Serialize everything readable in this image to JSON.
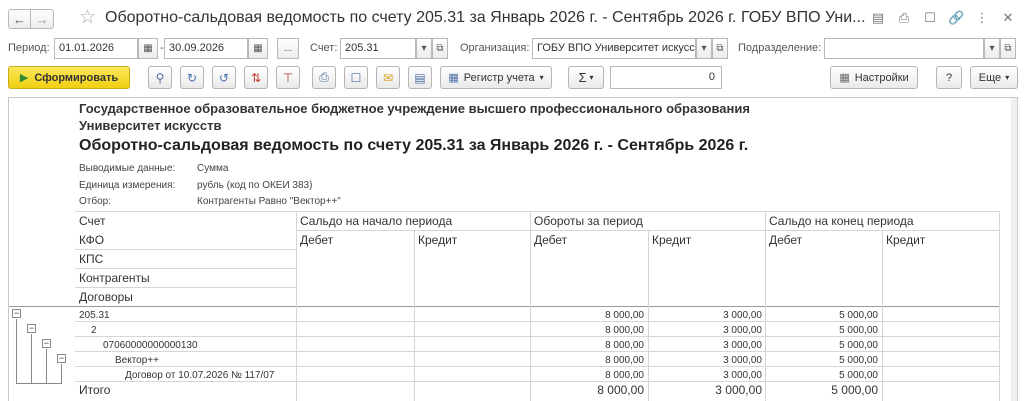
{
  "window": {
    "title": "Оборотно-сальдовая ведомость по счету 205.31 за Январь 2026 г. - Сентябрь 2026 г. ГОБУ ВПО Уни..."
  },
  "params": {
    "period_label": "Период:",
    "date_from": "01.01.2026",
    "date_to": "30.09.2026",
    "dots": "...",
    "account_label": "Счет:",
    "account_value": "205.31",
    "org_label": "Организация:",
    "org_value": "ГОБУ ВПО Университет искусс",
    "subdiv_label": "Подразделение:",
    "subdiv_value": ""
  },
  "toolbar": {
    "generate": "Сформировать",
    "register": "Регистр учета",
    "sigma": "Σ",
    "sum_value": "0",
    "settings": "Настройки",
    "help": "?",
    "more": "Еще"
  },
  "report": {
    "org_line1": "Государственное образовательное бюджетное учреждение высшего профессионального образования",
    "org_line2": "Университет искусств",
    "title": "Оборотно-сальдовая ведомость по счету 205.31 за Январь 2026 г. - Сентябрь 2026 г.",
    "meta": [
      {
        "label": "Выводимые данные:",
        "value": "Сумма"
      },
      {
        "label": "Единица измерения:",
        "value": "рубль (код по ОКЕИ 383)"
      },
      {
        "label": "Отбор:",
        "value": "Контрагенты Равно \"Вектор++\""
      }
    ],
    "header": {
      "col_account": "Счет",
      "col_kfo": "КФО",
      "col_kps": "КПС",
      "col_contractors": "Контрагенты",
      "col_contracts": "Договоры",
      "group_start": "Сальдо на начало периода",
      "group_turnover": "Обороты за период",
      "group_end": "Сальдо на конец периода",
      "debit": "Дебет",
      "credit": "Кредит"
    },
    "rows": [
      {
        "name": "205.31",
        "debit_turn": "8 000,00",
        "credit_turn": "3 000,00",
        "end_debit": "5 000,00"
      },
      {
        "name": "2",
        "debit_turn": "8 000,00",
        "credit_turn": "3 000,00",
        "end_debit": "5 000,00"
      },
      {
        "name": "07060000000000130",
        "debit_turn": "8 000,00",
        "credit_turn": "3 000,00",
        "end_debit": "5 000,00"
      },
      {
        "name": "Вектор++",
        "debit_turn": "8 000,00",
        "credit_turn": "3 000,00",
        "end_debit": "5 000,00"
      },
      {
        "name": "Договор от 10.07.2026 № 117/07",
        "debit_turn": "8 000,00",
        "credit_turn": "3 000,00",
        "end_debit": "5 000,00"
      }
    ],
    "total": {
      "name": "Итого",
      "debit_turn": "8 000,00",
      "credit_turn": "3 000,00",
      "end_debit": "5 000,00"
    }
  }
}
